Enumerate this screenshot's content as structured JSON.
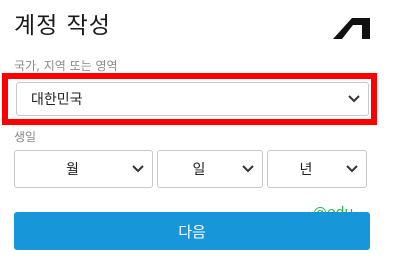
{
  "form": {
    "title": "계정 작성",
    "country_label": "국가, 지역 또는 영역",
    "country_value": "대한민국",
    "dob_label": "생일",
    "month_value": "월",
    "day_value": "일",
    "year_value": "년",
    "next_label": "다음"
  },
  "watermark": {
    "text": "@edu"
  },
  "icons": {
    "logo": "autodesk-logo-icon",
    "chevron": "chevron-down-icon"
  },
  "colors": {
    "highlight": "#ff0000",
    "primary_button": "#1796d9",
    "watermark": "#2bb83c"
  }
}
